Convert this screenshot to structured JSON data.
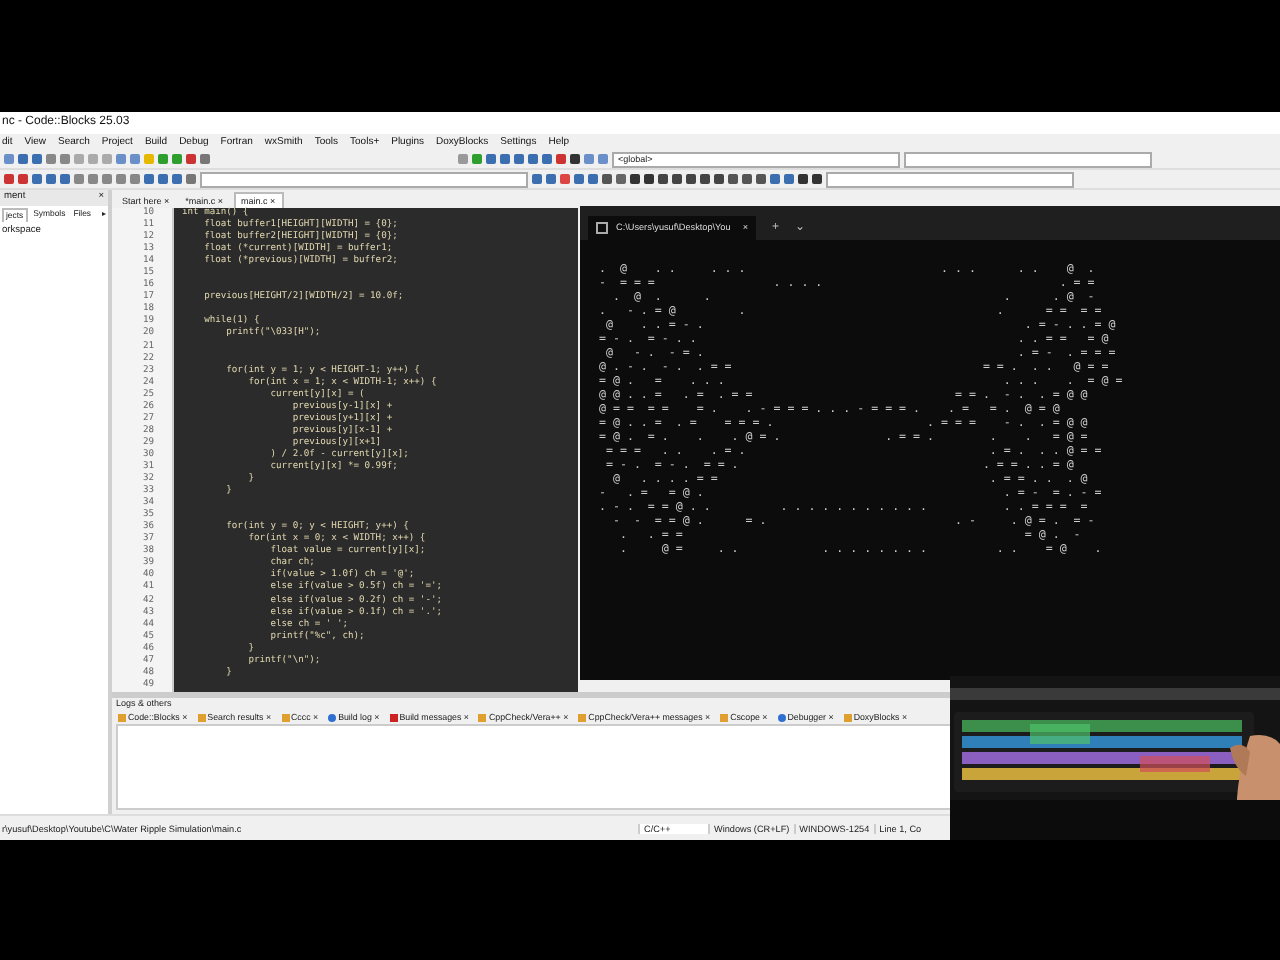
{
  "window": {
    "title": "nc - Code::Blocks 25.03"
  },
  "menu": [
    "dit",
    "View",
    "Search",
    "Project",
    "Build",
    "Debug",
    "Fortran",
    "wxSmith",
    "Tools",
    "Tools+",
    "Plugins",
    "DoxyBlocks",
    "Settings",
    "Help"
  ],
  "toolbar": {
    "scope": "<global>"
  },
  "management": {
    "title": "ment",
    "close": "×",
    "tabs": [
      {
        "label": "jects",
        "selected": true
      },
      {
        "label": "Symbols",
        "selected": false
      },
      {
        "label": "Files",
        "selected": false
      }
    ],
    "more": "▸",
    "tree": [
      {
        "label": "orkspace"
      }
    ]
  },
  "editor": {
    "tabs": [
      {
        "label": "Start here",
        "close": "×",
        "selected": false
      },
      {
        "label": "*main.c",
        "close": "×",
        "selected": false
      },
      {
        "label": "main.c",
        "close": "×",
        "selected": true
      }
    ],
    "lines": [
      {
        "number": "10",
        "code": "int main() {"
      },
      {
        "number": "11",
        "code": "    float buffer1[HEIGHT][WIDTH] = {0};"
      },
      {
        "number": "12",
        "code": "    float buffer2[HEIGHT][WIDTH] = {0};"
      },
      {
        "number": "13",
        "code": "    float (*current)[WIDTH] = buffer1;"
      },
      {
        "number": "14",
        "code": "    float (*previous)[WIDTH] = buffer2;"
      },
      {
        "number": "15"
      },
      {
        "number": "16"
      },
      {
        "number": "17",
        "code": "    previous[HEIGHT/2][WIDTH/2] = 10.0f;"
      },
      {
        "number": "18"
      },
      {
        "number": "19",
        "code": "    while(1) {"
      },
      {
        "number": "20",
        "code": "        printf(\"\\033[H\");"
      },
      {
        "number": "21"
      },
      {
        "number": "22"
      },
      {
        "number": "23",
        "code": "        for(int y = 1; y < HEIGHT-1; y++) {"
      },
      {
        "number": "24",
        "code": "            for(int x = 1; x < WIDTH-1; x++) {"
      },
      {
        "number": "25",
        "code": "                current[y][x] = ("
      },
      {
        "number": "26",
        "code": "                    previous[y-1][x] +"
      },
      {
        "number": "27",
        "code": "                    previous[y+1][x] +"
      },
      {
        "number": "28",
        "code": "                    previous[y][x-1] +"
      },
      {
        "number": "29",
        "code": "                    previous[y][x+1]"
      },
      {
        "number": "30",
        "code": "                ) / 2.0f - current[y][x];"
      },
      {
        "number": "31",
        "code": "                current[y][x] *= 0.99f;"
      },
      {
        "number": "32",
        "code": "            }"
      },
      {
        "number": "33",
        "code": "        }"
      },
      {
        "number": "34"
      },
      {
        "number": "35"
      },
      {
        "number": "36",
        "code": "        for(int y = 0; y < HEIGHT; y++) {"
      },
      {
        "number": "37",
        "code": "            for(int x = 0; x < WIDTH; x++) {"
      },
      {
        "number": "38",
        "code": "                float value = current[y][x];"
      },
      {
        "number": "39",
        "code": "                char ch;"
      },
      {
        "number": "40",
        "code": "                if(value > 1.0f) ch = '@';"
      },
      {
        "number": "41",
        "code": "                else if(value > 0.5f) ch = '=';"
      },
      {
        "number": "42",
        "code": "                else if(value > 0.2f) ch = '-';"
      },
      {
        "number": "43",
        "code": "                else if(value > 0.1f) ch = '.';"
      },
      {
        "number": "44",
        "code": "                else ch = ' ';"
      },
      {
        "number": "45",
        "code": "                printf(\"%c\", ch);"
      },
      {
        "number": "46",
        "code": "            }"
      },
      {
        "number": "47",
        "code": "            printf(\"\\n\");"
      },
      {
        "number": "48",
        "code": "        }"
      },
      {
        "number": "49"
      }
    ]
  },
  "terminal": {
    "tab": "C:\\Users\\yusuf\\Desktop\\You",
    "close": "×",
    "new_tab": "+",
    "dropdown": "⌄",
    "output": [
      " .  @    . .     . . .                            . . .      . .    @  .",
      " -  = = =                 . . . .                                  . = =",
      "   .  @  .      .                                          .      . @  -",
      " .   - . = @         .                                    .      = =  = =",
      "  @    . . = - .                                              . = - . . = @",
      " = - .  = - . .                                              . . = =   = @",
      "  @   - .  - = .                                             . = -  . = = =",
      " @ . - .  - .  . = =                                    = = .  . .   @ = =",
      " = @ .   =    . . .                                        . . .    .  = @ =",
      " @ @ . . =   . =  . = =                             = = .  - .  . = @ @",
      " @ = =  = =    = .    . - = = = . . . - = = = .    . =   = .  @ = @",
      " = @ . . =  . =    = = = .                      . = = =    - .  . = @ @",
      " = @ .  = .    .    . @ = .               . = = .        .    .   = @ =",
      "  = = =   . .    . = .                                   . = .  . . @ = =",
      "  = - .  = - .  = = .                                   . = = . . = @",
      "   @   . . . . = =                                       . = = . .  . @",
      " -   . =   = @ .                                           . = -  = . - =",
      " . - .  = = @ . .          . . . . . . . . . . .           . . = = =  =",
      "   -  -  = = @ .      = .                           . -     . @ = .  = -",
      "    .   . = =                                                 = @ .  -",
      "    .     @ =     . .            . . . . . . . .          . .    = @    ."
    ]
  },
  "logs": {
    "title": "Logs & others",
    "tabs": [
      {
        "label": "Code::Blocks",
        "close": "×",
        "selected": false
      },
      {
        "label": "Search results",
        "close": "×",
        "selected": false
      },
      {
        "label": "Cccc",
        "close": "×",
        "selected": false
      },
      {
        "label": "Build log",
        "close": "×",
        "selected": false
      },
      {
        "label": "Build messages",
        "close": "×",
        "selected": false
      },
      {
        "label": "CppCheck/Vera++",
        "close": "×",
        "selected": false
      },
      {
        "label": "CppCheck/Vera++ messages",
        "close": "×",
        "selected": false
      },
      {
        "label": "Cscope",
        "close": "×",
        "selected": false
      },
      {
        "label": "Debugger",
        "close": "×",
        "selected": false
      },
      {
        "label": "DoxyBlocks",
        "close": "×",
        "selected": false
      }
    ]
  },
  "status_bar": {
    "path": "r\\yusuf\\Desktop\\Youtube\\C\\Water Ripple Simulation\\main.c",
    "language": "C/C++",
    "line_endings": "Windows (CR+LF)",
    "encoding": "WINDOWS-1254",
    "position": "Line 1, Co"
  }
}
